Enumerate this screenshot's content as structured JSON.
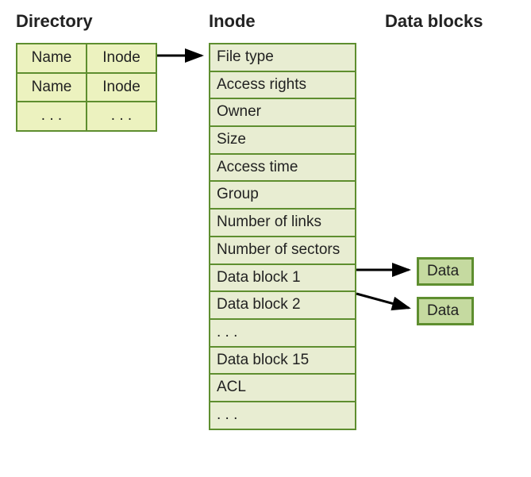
{
  "headings": {
    "directory": "Directory",
    "inode": "Inode",
    "datablocks": "Data blocks"
  },
  "directory": {
    "rows": [
      {
        "name": "Name",
        "inode": "Inode"
      },
      {
        "name": "Name",
        "inode": "Inode"
      },
      {
        "name": ". . .",
        "inode": ". . ."
      }
    ]
  },
  "inode": {
    "fields": [
      "File type",
      "Access rights",
      "Owner",
      "Size",
      "Access time",
      "Group",
      "Number of links",
      "Number of sectors",
      "Data block 1",
      "Data block 2",
      ". . .",
      "Data block 15",
      "ACL",
      ". . ."
    ]
  },
  "datablocks": {
    "items": [
      "Data",
      "Data"
    ]
  }
}
